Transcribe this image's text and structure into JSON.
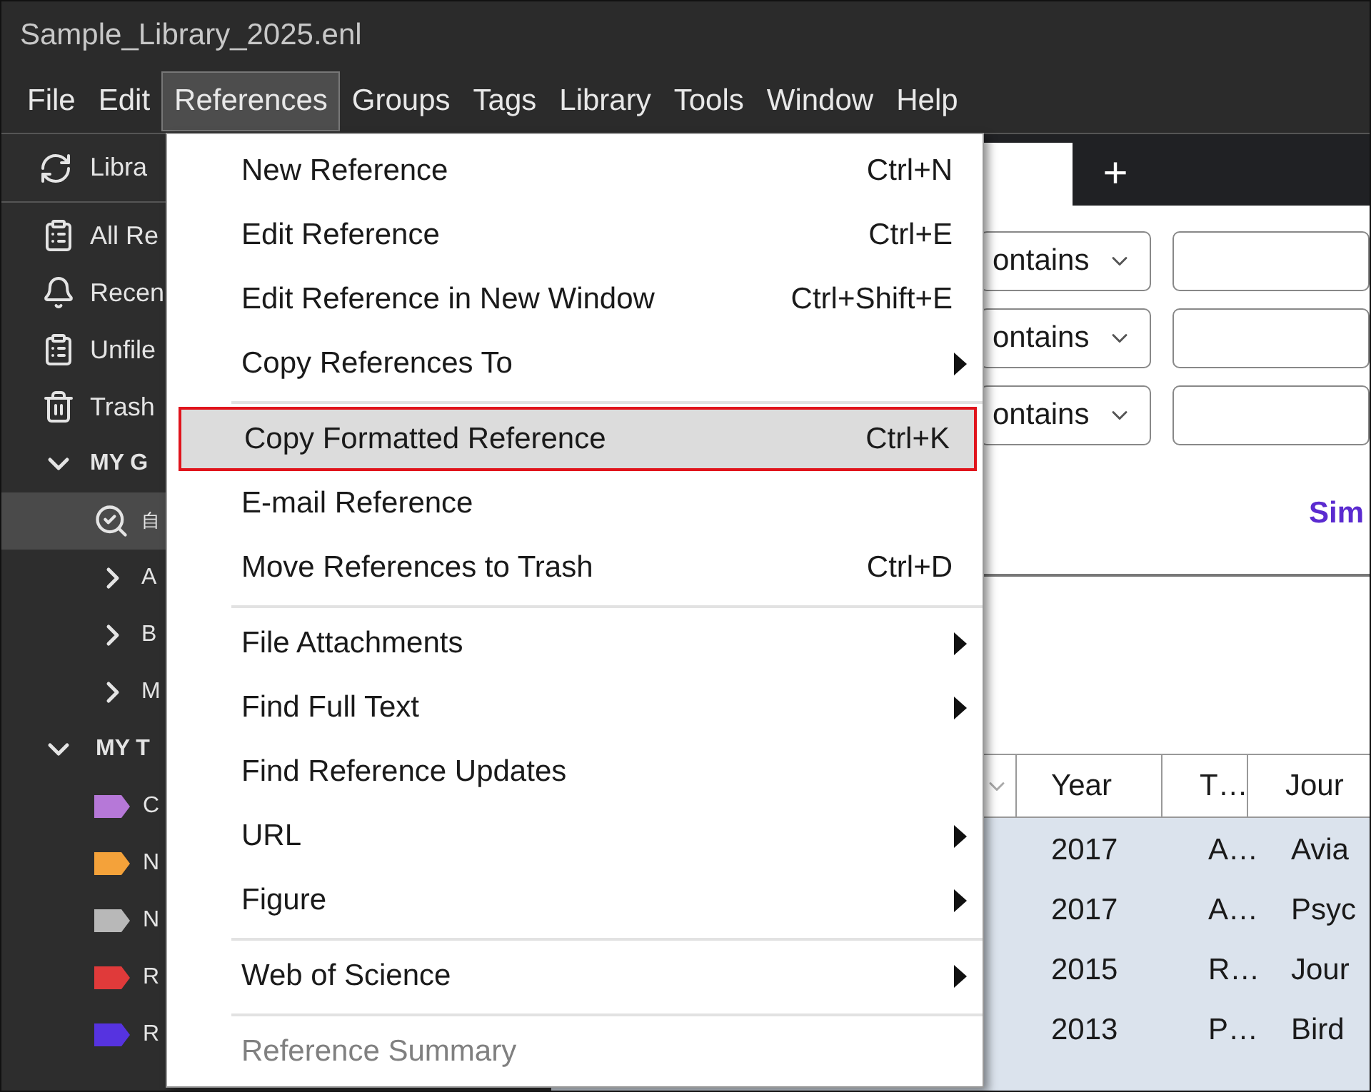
{
  "window": {
    "title": "Sample_Library_2025.enl"
  },
  "menu_bar": [
    {
      "label": "File",
      "selected": false
    },
    {
      "label": "Edit",
      "selected": false
    },
    {
      "label": "References",
      "selected": true
    },
    {
      "label": "Groups",
      "selected": false
    },
    {
      "label": "Tags",
      "selected": false
    },
    {
      "label": "Library",
      "selected": false
    },
    {
      "label": "Tools",
      "selected": false
    },
    {
      "label": "Window",
      "selected": false
    },
    {
      "label": "Help",
      "selected": false
    }
  ],
  "sidebar": {
    "sync_item": "Libra",
    "items": [
      "All Re",
      "Recen",
      "Unfile",
      "Trash"
    ],
    "groups_heading": {
      "label": "MY G",
      "expanded": true
    },
    "groups": [
      {
        "kind": "smart",
        "label": "自",
        "selected": true
      },
      {
        "kind": "group",
        "label": "A",
        "selected": false,
        "expanded": false
      },
      {
        "kind": "group",
        "label": "B",
        "selected": false,
        "expanded": false
      },
      {
        "kind": "group",
        "label": "M",
        "selected": false,
        "expanded": false
      }
    ],
    "tags_heading": {
      "label": "MY T",
      "expanded": true
    },
    "tags": [
      {
        "label": "C",
        "color": "#b678d8"
      },
      {
        "label": "N",
        "color": "#f4a23a"
      },
      {
        "label": "N",
        "color": "#b8b8b8"
      },
      {
        "label": "R",
        "color": "#e03a3a"
      },
      {
        "label": "R",
        "color": "#5633e0"
      }
    ]
  },
  "tabs": {
    "add_label": "+"
  },
  "search": {
    "rows": [
      {
        "operator": "ontains"
      },
      {
        "operator": "ontains"
      },
      {
        "operator": "ontains"
      }
    ],
    "link": "Sim"
  },
  "table": {
    "columns": [
      "Year",
      "T…",
      "Jour"
    ],
    "rows": [
      [
        "2017",
        "A…",
        "Avia"
      ],
      [
        "2017",
        "A…",
        "Psyc"
      ],
      [
        "2015",
        "R…",
        "Jour"
      ],
      [
        "2013",
        "P…",
        "Bird"
      ]
    ]
  },
  "references_menu": {
    "sections": [
      [
        {
          "kind": "command",
          "label": "New Reference",
          "shortcut": "Ctrl+N",
          "selected": false,
          "disabled": false
        },
        {
          "kind": "command",
          "label": "Edit Reference",
          "shortcut": "Ctrl+E",
          "selected": false,
          "disabled": false
        },
        {
          "kind": "command",
          "label": "Edit Reference in New Window",
          "shortcut": "Ctrl+Shift+E",
          "selected": false,
          "disabled": false
        },
        {
          "kind": "submenu",
          "label": "Copy References To",
          "selected": false,
          "disabled": false
        }
      ],
      [
        {
          "kind": "command",
          "label": "Copy Formatted Reference",
          "shortcut": "Ctrl+K",
          "selected": true,
          "disabled": false
        },
        {
          "kind": "command",
          "label": "E-mail Reference",
          "selected": false,
          "disabled": false
        },
        {
          "kind": "command",
          "label": "Move References to Trash",
          "shortcut": "Ctrl+D",
          "selected": false,
          "disabled": false
        }
      ],
      [
        {
          "kind": "submenu",
          "label": "File Attachments",
          "selected": false,
          "disabled": false
        },
        {
          "kind": "submenu",
          "label": "Find Full Text",
          "selected": false,
          "disabled": false
        },
        {
          "kind": "command",
          "label": "Find Reference Updates",
          "selected": false,
          "disabled": false
        },
        {
          "kind": "submenu",
          "label": "URL",
          "selected": false,
          "disabled": false
        },
        {
          "kind": "submenu",
          "label": "Figure",
          "selected": false,
          "disabled": false
        }
      ],
      [
        {
          "kind": "submenu",
          "label": "Web of Science",
          "selected": false,
          "disabled": false
        }
      ],
      [
        {
          "kind": "command",
          "label": "Reference Summary",
          "selected": false,
          "disabled": true
        }
      ]
    ]
  }
}
